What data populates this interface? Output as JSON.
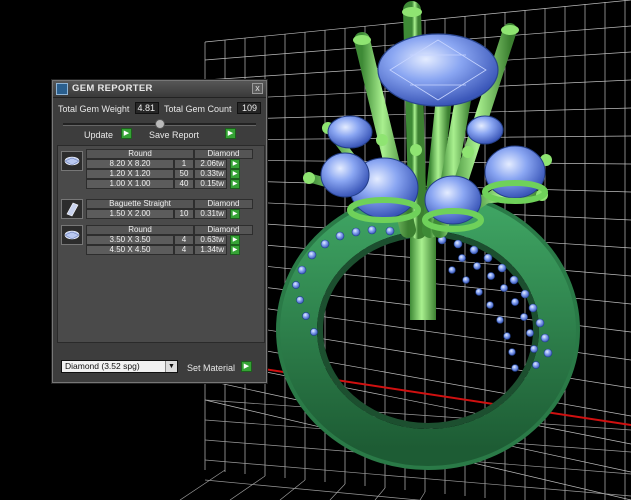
{
  "panel": {
    "title": "GEM REPORTER",
    "close_glyph": "x",
    "total_weight_label": "Total Gem Weight",
    "total_weight_value": "4.81",
    "total_count_label": "Total Gem Count",
    "total_count_value": "109",
    "update_label": "Update",
    "save_report_label": "Save Report",
    "arrow_glyph": "▶"
  },
  "gems": [
    {
      "shape": "Round",
      "material": "Diamond",
      "icon": "round-gem-icon",
      "rows": [
        {
          "size": "8.20 X 8.20",
          "count": "1",
          "weight": "2.06tw"
        },
        {
          "size": "1.20 X 1.20",
          "count": "50",
          "weight": "0.33tw"
        },
        {
          "size": "1.00 X 1.00",
          "count": "40",
          "weight": "0.15tw"
        }
      ]
    },
    {
      "shape": "Baguette Straight",
      "material": "Diamond",
      "icon": "baguette-gem-icon",
      "rows": [
        {
          "size": "1.50 X 2.00",
          "count": "10",
          "weight": "0.31tw"
        }
      ]
    },
    {
      "shape": "Round",
      "material": "Diamond",
      "icon": "round-gem-icon",
      "rows": [
        {
          "size": "3.50 X 3.50",
          "count": "4",
          "weight": "0.63tw"
        },
        {
          "size": "4.50 X 4.50",
          "count": "4",
          "weight": "1.34tw"
        }
      ]
    }
  ],
  "material": {
    "selected": "Diamond    (3.52 spg)",
    "dropdown_glyph": "▼",
    "set_material_label": "Set Material"
  },
  "colors": {
    "background": "#000000",
    "grid": "#cfcfcf",
    "ring_green": "#2e8b4e",
    "prong_green": "#74d65c",
    "gem_blue": "#7d9cf0",
    "accent_red": "#d01010",
    "button_green": "#35a335"
  }
}
